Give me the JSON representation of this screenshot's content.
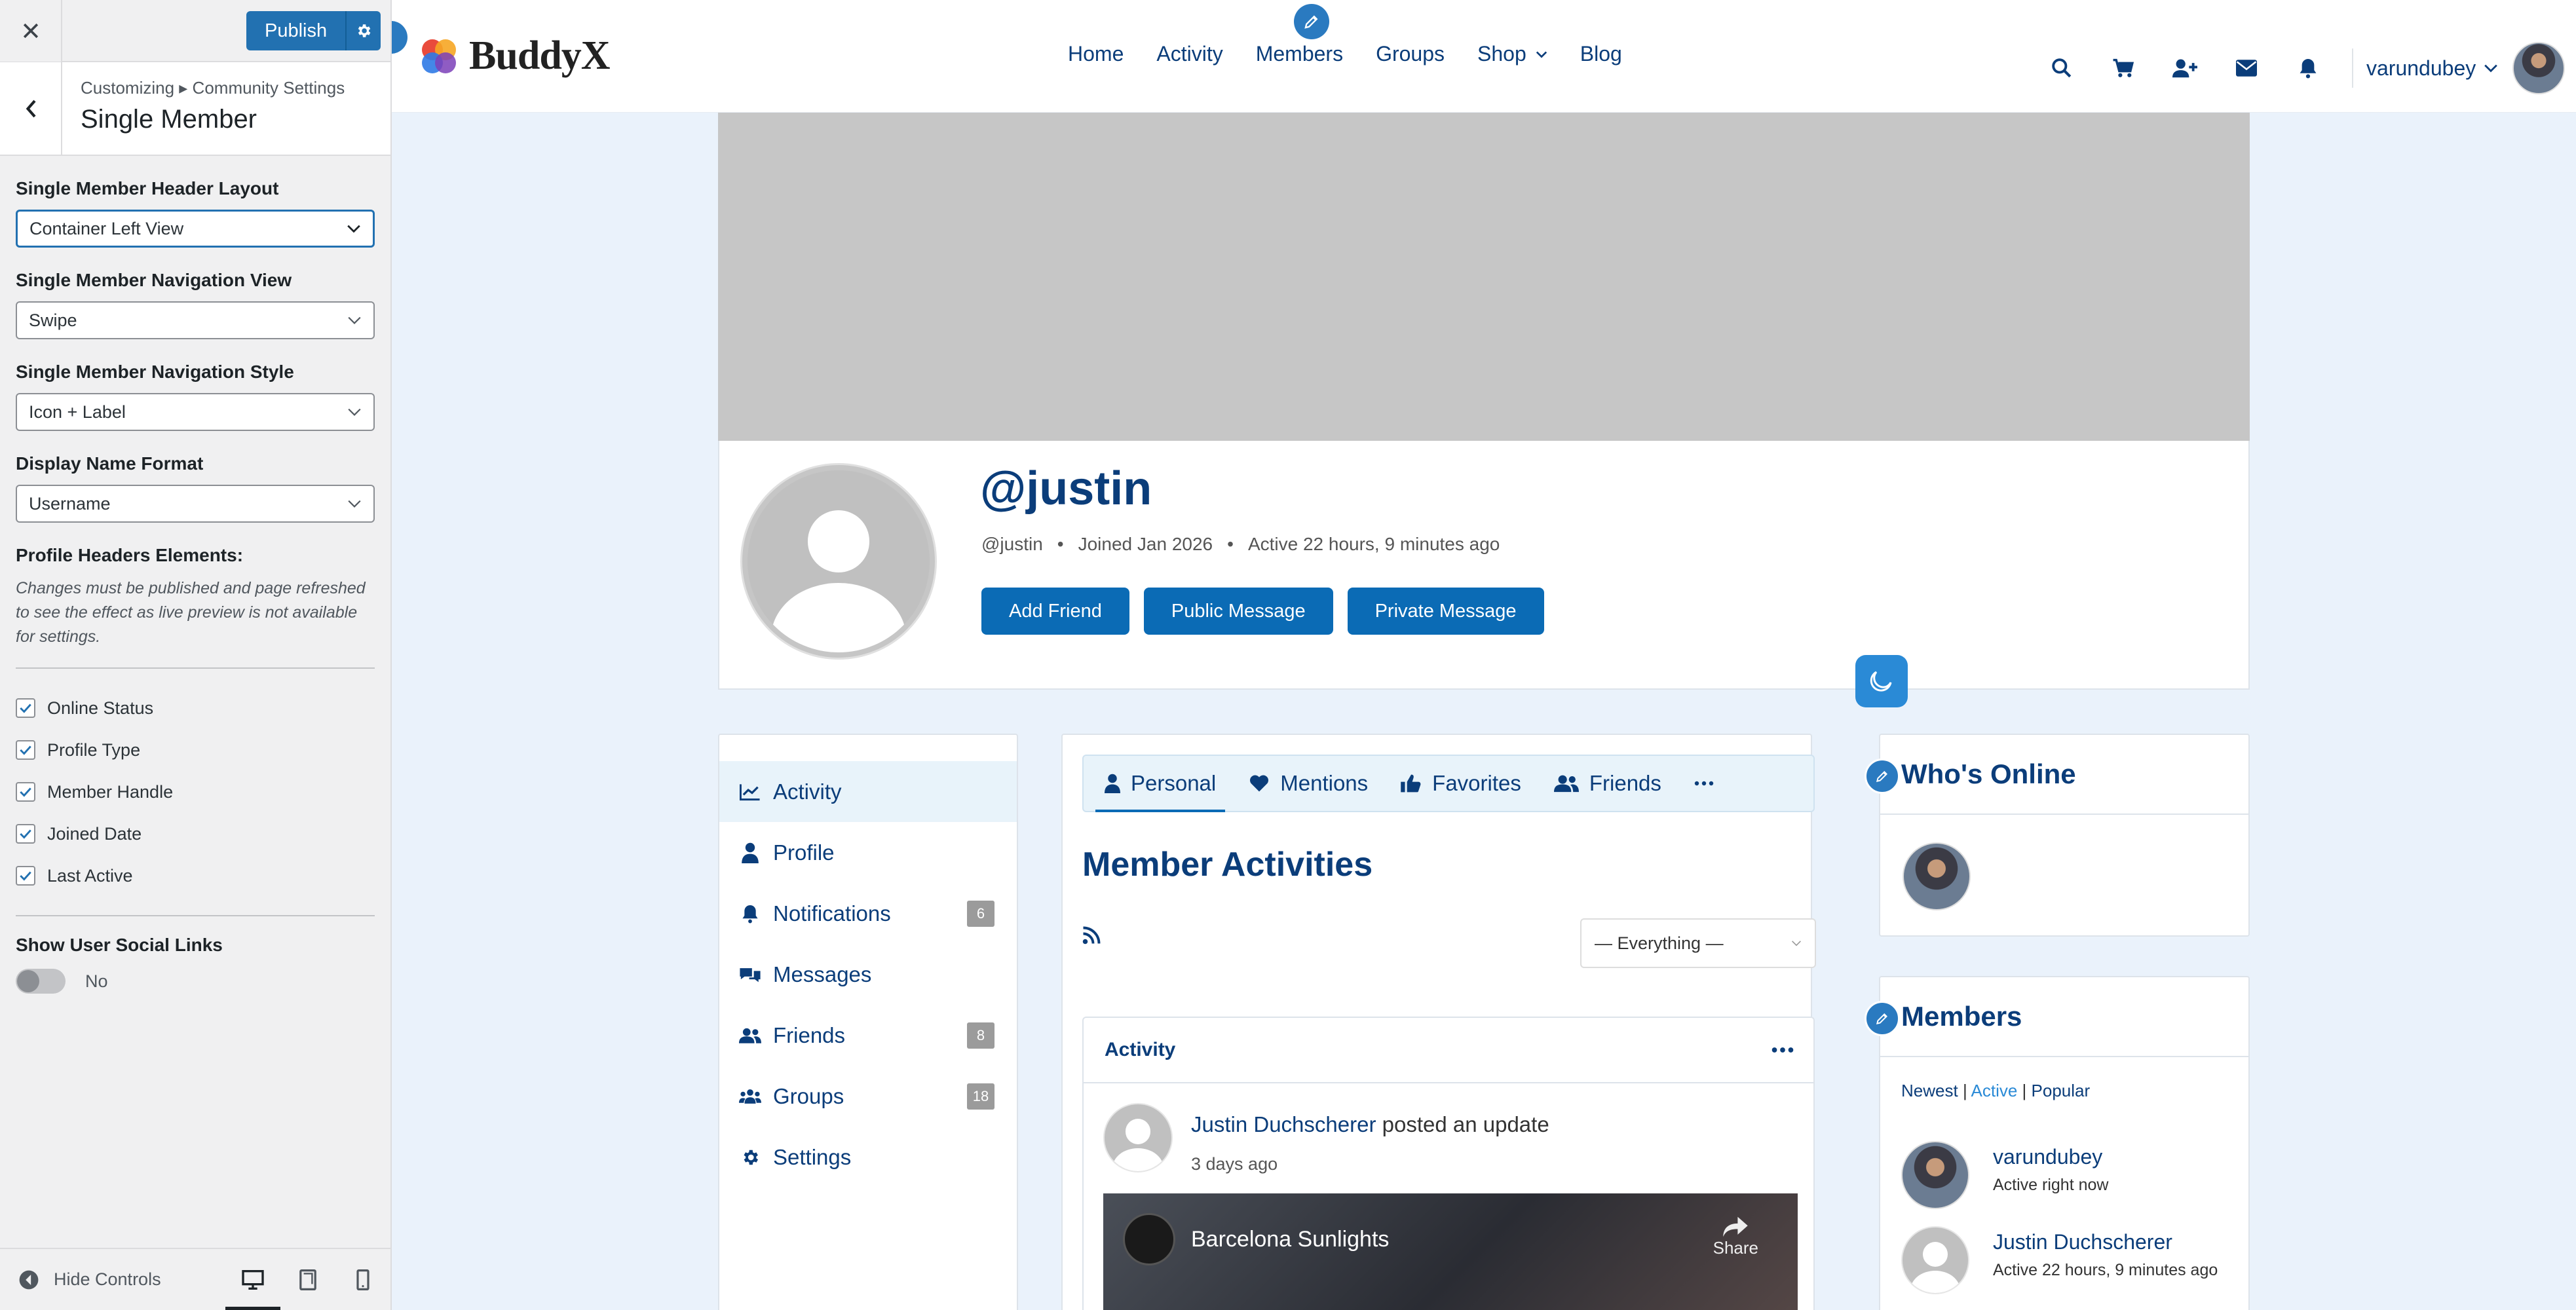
{
  "customizer": {
    "publish_label": "Publish",
    "breadcrumb": "Customizing ▸ Community Settings",
    "section_title": "Single Member",
    "controls": [
      {
        "label": "Single Member Header Layout",
        "value": "Container Left View"
      },
      {
        "label": "Single Member Navigation View",
        "value": "Swipe"
      },
      {
        "label": "Single Member Navigation Style",
        "value": "Icon + Label"
      },
      {
        "label": "Display Name Format",
        "value": "Username"
      }
    ],
    "profile_headers_label": "Profile Headers Elements:",
    "profile_headers_desc": "Changes must be published and page refreshed to see the effect as live preview is not available for settings.",
    "checkboxes": [
      {
        "label": "Online Status",
        "checked": true
      },
      {
        "label": "Profile Type",
        "checked": true
      },
      {
        "label": "Member Handle",
        "checked": true
      },
      {
        "label": "Joined Date",
        "checked": true
      },
      {
        "label": "Last Active",
        "checked": true
      }
    ],
    "social_links_label": "Show User Social Links",
    "social_links_value": "No",
    "hide_controls_label": "Hide Controls"
  },
  "site": {
    "logo_text": "BuddyX",
    "nav": [
      "Home",
      "Activity",
      "Members",
      "Groups",
      "Shop",
      "Blog"
    ],
    "username": "varundubey"
  },
  "profile": {
    "name": "@justin",
    "handle": "@justin",
    "joined": "Joined Jan 2026",
    "active": "Active 22 hours, 9 minutes ago",
    "buttons": [
      "Add Friend",
      "Public Message",
      "Private Message"
    ]
  },
  "member_nav": [
    {
      "label": "Activity",
      "count": ""
    },
    {
      "label": "Profile",
      "count": ""
    },
    {
      "label": "Notifications",
      "count": "6"
    },
    {
      "label": "Messages",
      "count": ""
    },
    {
      "label": "Friends",
      "count": "8"
    },
    {
      "label": "Groups",
      "count": "18"
    },
    {
      "label": "Settings",
      "count": ""
    }
  ],
  "activity": {
    "subtabs": [
      "Personal",
      "Mentions",
      "Favorites",
      "Friends"
    ],
    "title": "Member Activities",
    "filter": "— Everything —",
    "card_title": "Activity",
    "post_author": "Justin Duchscherer",
    "post_action": "posted an update",
    "post_time": "3 days ago",
    "video_title": "Barcelona Sunlights",
    "video_share": "Share"
  },
  "widgets": {
    "online_title": "Who's Online",
    "members_title": "Members",
    "members_tabs": [
      "Newest",
      "Active",
      "Popular"
    ],
    "members": [
      {
        "name": "varundubey",
        "status": "Active right now"
      },
      {
        "name": "Justin Duchscherer",
        "status": "Active 22 hours, 9 minutes ago"
      }
    ]
  }
}
